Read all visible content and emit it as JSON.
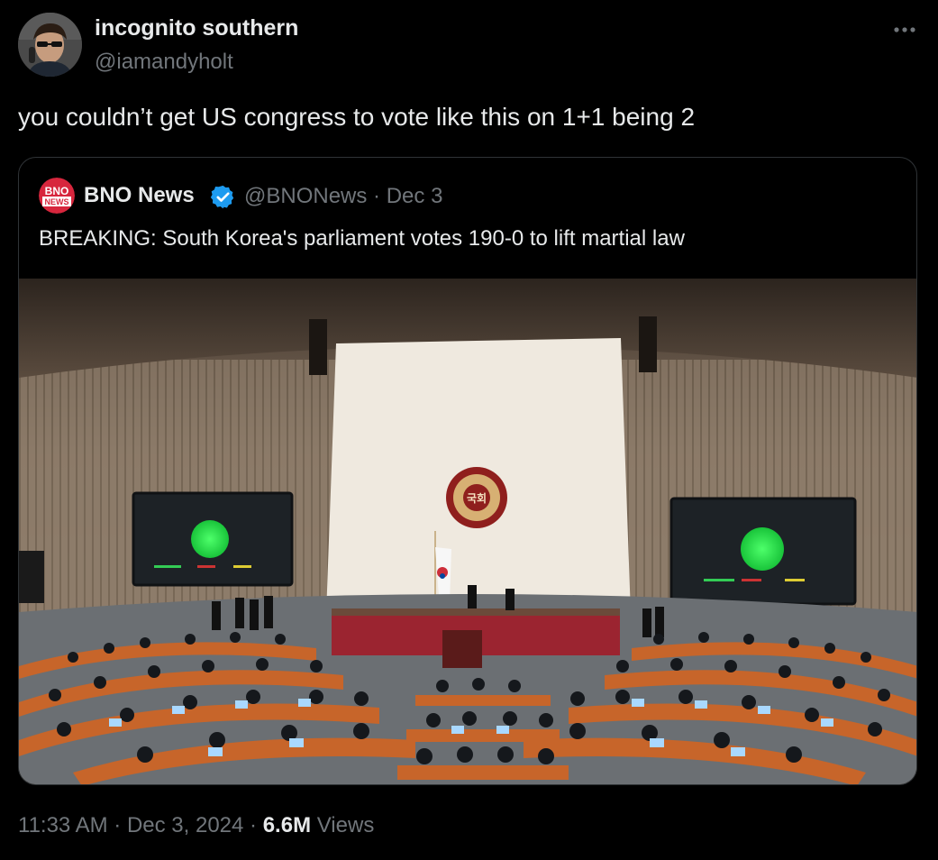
{
  "post": {
    "author_name": "incognito southern",
    "author_handle": "@iamandyholt",
    "text": "you couldn’t get US congress to vote like this on 1+1 being 2",
    "timestamp": "11:33 AM · Dec 3, 2024 · ",
    "views_count": "6.6M",
    "views_label": " Views"
  },
  "quote": {
    "logo_text_top": "BNO",
    "logo_text_bottom": "NEWS",
    "name": "BNO News",
    "handle": "@BNONews",
    "separator": " · ",
    "date": "Dec 3",
    "text": "BREAKING: South Korea's parliament votes 190-0 to lift martial law",
    "emblem_text": "국회"
  },
  "colors": {
    "background": "#000000",
    "text_primary": "#e7e9ea",
    "text_secondary": "#71767b",
    "border": "#2f3336",
    "verified": "#1d9bf0"
  }
}
